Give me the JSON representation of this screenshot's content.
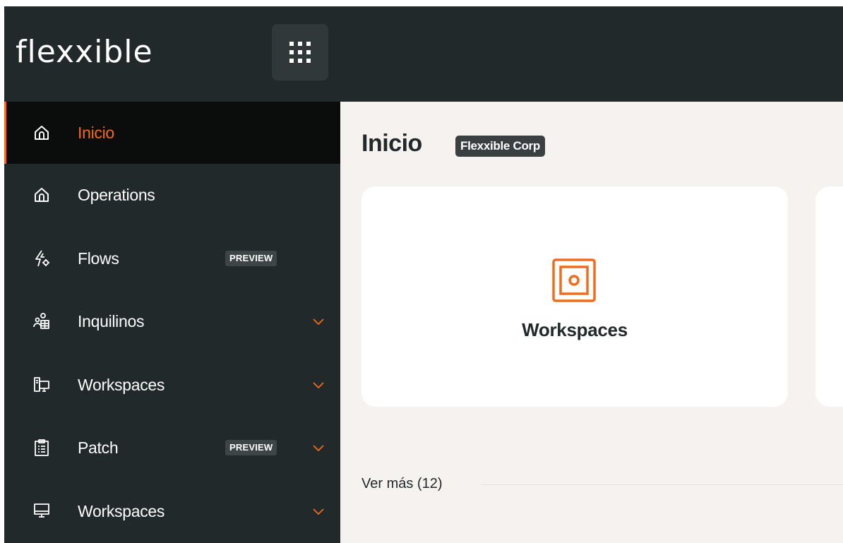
{
  "brand": {
    "logo_text": "flexxible",
    "accent_color": "#ef6c1f"
  },
  "header": {
    "apps_icon": "grid-dots-icon"
  },
  "sidebar": {
    "items": [
      {
        "label": "Inicio",
        "icon": "home-icon",
        "active": true
      },
      {
        "label": "Operations",
        "icon": "home-icon"
      },
      {
        "label": "Flows",
        "icon": "flash-gear-icon",
        "badge": "PREVIEW"
      },
      {
        "label": "Inquilinos",
        "icon": "users-building-icon",
        "expandable": true
      },
      {
        "label": "Workspaces",
        "icon": "devices-icon",
        "expandable": true
      },
      {
        "label": "Patch",
        "icon": "clipboard-list-icon",
        "badge": "PREVIEW",
        "expandable": true
      },
      {
        "label": "Workspaces",
        "icon": "monitor-icon",
        "expandable": true
      }
    ]
  },
  "main": {
    "title": "Inicio",
    "org_badge": "Flexxible Corp",
    "cards": [
      {
        "label": "Workspaces",
        "icon": "workspace-icon"
      }
    ],
    "more_link": "Ver más (12)"
  }
}
